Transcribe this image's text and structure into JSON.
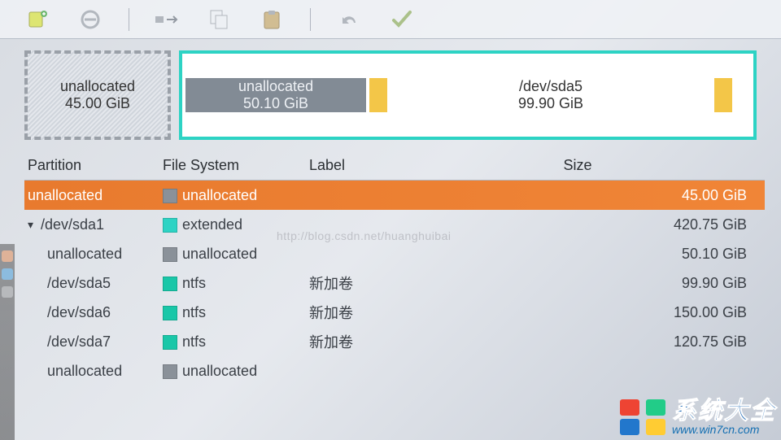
{
  "toolbar": {
    "icons": [
      "new-icon",
      "delete-icon",
      "resize-icon",
      "copy-icon",
      "paste-icon",
      "undo-icon",
      "apply-icon"
    ]
  },
  "partition_bar": {
    "outer": {
      "name": "unallocated",
      "size": "45.00 GiB"
    },
    "extended": {
      "unalloc": {
        "name": "unallocated",
        "size": "50.10 GiB"
      },
      "ntfs1": {
        "name": "/dev/sda5",
        "size": "99.90 GiB"
      }
    }
  },
  "table": {
    "headers": {
      "partition": "Partition",
      "fs": "File System",
      "label": "Label",
      "size": "Size"
    },
    "rows": [
      {
        "indent": 1,
        "partition": "unallocated",
        "fs": "unallocated",
        "swatch": "sw-unalloc",
        "label": "",
        "size": "45.00 GiB",
        "selected": true
      },
      {
        "indent": 1,
        "expander": "▾",
        "partition": "/dev/sda1",
        "fs": "extended",
        "swatch": "sw-extended",
        "label": "",
        "size": "420.75 GiB"
      },
      {
        "indent": 2,
        "partition": "unallocated",
        "fs": "unallocated",
        "swatch": "sw-unalloc",
        "label": "",
        "size": "50.10 GiB"
      },
      {
        "indent": 2,
        "partition": "/dev/sda5",
        "fs": "ntfs",
        "swatch": "sw-ntfs",
        "label": "新加卷",
        "size": "99.90 GiB"
      },
      {
        "indent": 2,
        "partition": "/dev/sda6",
        "fs": "ntfs",
        "swatch": "sw-ntfs",
        "label": "新加卷",
        "size": "150.00 GiB"
      },
      {
        "indent": 2,
        "partition": "/dev/sda7",
        "fs": "ntfs",
        "swatch": "sw-ntfs",
        "label": "新加卷",
        "size": "120.75 GiB"
      },
      {
        "indent": 2,
        "partition": "unallocated",
        "fs": "unallocated",
        "swatch": "sw-unalloc",
        "label": "",
        "size": ""
      }
    ]
  },
  "watermark": "http://blog.csdn.net/huanghuibai",
  "logo": {
    "cn": "系统大全",
    "url": "www.win7cn.com"
  }
}
